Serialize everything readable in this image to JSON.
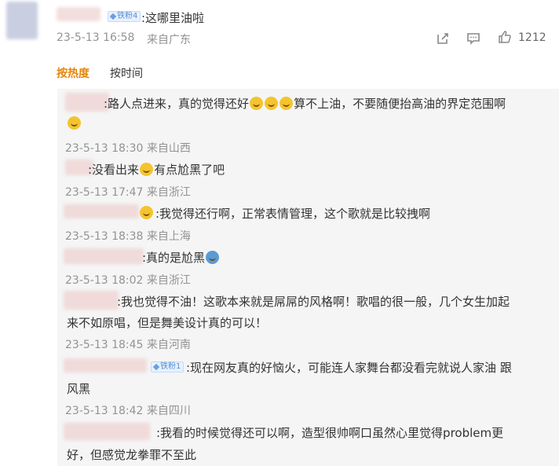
{
  "top_comment": {
    "badge": "铁粉4",
    "text": ":这哪里油啦",
    "date": "23-5-13 16:58",
    "location": "来自广东",
    "like_count": "1212",
    "icons": [
      "share-icon",
      "comment-icon",
      "like-icon"
    ]
  },
  "sort": {
    "hot": "按热度",
    "time": "按时间"
  },
  "replies": [
    {
      "lines": [
        ":路人点进来，真的觉得还好",
        "算不上油，不要随便抬高油的界定范围啊"
      ],
      "date": "23-5-13 18:30 来自山西"
    },
    {
      "lines": [
        ":没看出来",
        "有点尬黑了吧"
      ],
      "date": "23-5-13 17:47 来自浙江"
    },
    {
      "lines": [
        ":我觉得还行啊，正常表情管理，这个歌就是比较拽啊"
      ],
      "date": "23-5-13 18:38 来自上海"
    },
    {
      "lines": [
        ":真的是尬黑"
      ],
      "date": "23-5-13 18:02 来自浙江"
    },
    {
      "lines": [
        ":我也觉得不油！这歌本来就是屌屌的风格啊！歌唱的很一般，几个女生加起",
        "来不如原唱，但是舞美设计真的可以！"
      ],
      "date": "23-5-13 18:45 来自河南"
    },
    {
      "badge": "铁粉1",
      "lines": [
        ":现在网友真的好恼火，可能连人家舞台都没看完就说人家油 跟",
        "风黑"
      ],
      "date": "23-5-13 18:42 来自四川"
    },
    {
      "lines": [
        ":我看的时候觉得还可以啊，造型很帅啊口虽然心里觉得problem更",
        "好，但感觉龙拳罪不至此"
      ]
    }
  ]
}
